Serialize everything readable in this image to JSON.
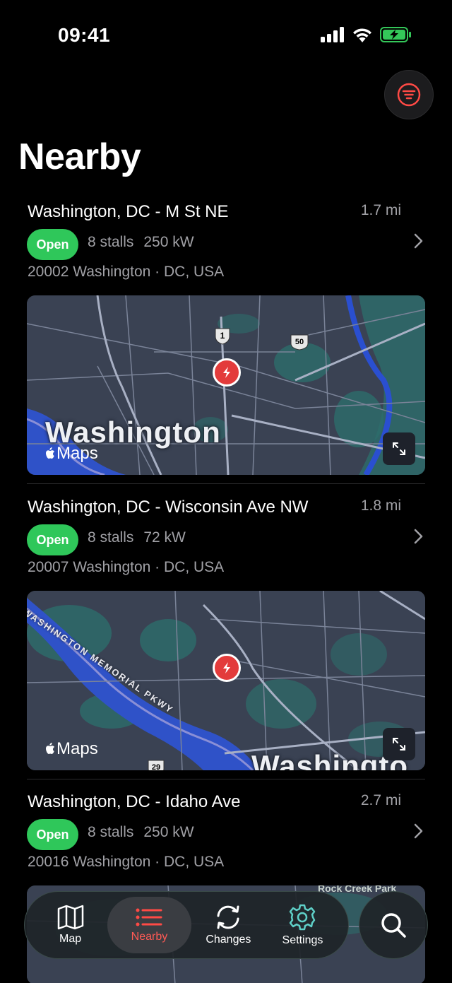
{
  "status_bar": {
    "time": "09:41"
  },
  "page": {
    "title": "Nearby"
  },
  "stations": [
    {
      "name": "Washington, DC - M St NE",
      "distance": "1.7 mi",
      "status": "Open",
      "stalls": "8 stalls",
      "power": "250 kW",
      "address": "20002 Washington · DC, USA",
      "map": {
        "city_label": "Washington",
        "attribution": "Maps",
        "route_shields": [
          "1",
          "50"
        ]
      }
    },
    {
      "name": "Washington, DC - Wisconsin Ave NW",
      "distance": "1.8 mi",
      "status": "Open",
      "stalls": "8 stalls",
      "power": "72 kW",
      "address": "20007 Washington · DC, USA",
      "map": {
        "city_label": "Washingto",
        "attribution": "Maps",
        "road_label": "WASHINGTON MEMORIAL PKWY",
        "route_shields": [
          "29"
        ]
      }
    },
    {
      "name": "Washington, DC - Idaho Ave",
      "distance": "2.7 mi",
      "status": "Open",
      "stalls": "8 stalls",
      "power": "250 kW",
      "address": "20016 Washington · DC, USA",
      "map": {
        "park_label": "Rock Creek Park"
      }
    }
  ],
  "tab_bar": {
    "tabs": [
      {
        "label": "Map",
        "icon": "map-icon"
      },
      {
        "label": "Nearby",
        "icon": "list-icon",
        "active": true
      },
      {
        "label": "Changes",
        "icon": "refresh-icon"
      },
      {
        "label": "Settings",
        "icon": "gear-icon"
      }
    ],
    "search_icon": "search-icon"
  },
  "colors": {
    "accent": "#ff5a55",
    "open_badge": "#2fc75a",
    "pin": "#e33b3b"
  }
}
